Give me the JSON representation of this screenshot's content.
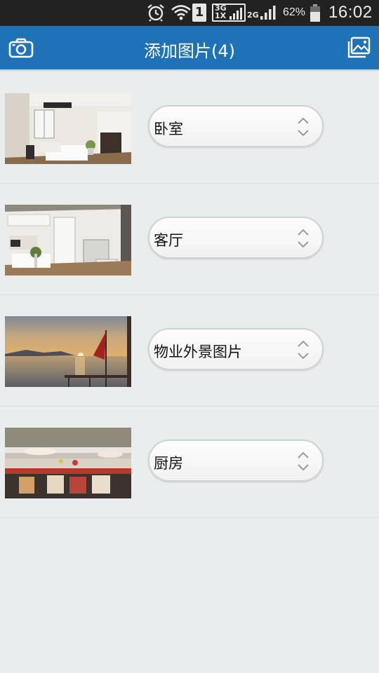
{
  "status_bar": {
    "sim_slot": "1",
    "net_primary": "3G",
    "net_secondary": "1X",
    "net_tertiary": "2G",
    "battery_percent": "62%",
    "time": "16:02"
  },
  "navbar": {
    "title": "添加图片(4)",
    "left_icon": "camera-icon",
    "right_icon": "gallery-icon",
    "color": "#1f72b8"
  },
  "items": [
    {
      "label": "卧室",
      "thumbnail": "bedroom-photo"
    },
    {
      "label": "客厅",
      "thumbnail": "living-room-photo"
    },
    {
      "label": "物业外景图片",
      "thumbnail": "lake-sunset-photo"
    },
    {
      "label": "厨房",
      "thumbnail": "kitchen-photo"
    }
  ]
}
